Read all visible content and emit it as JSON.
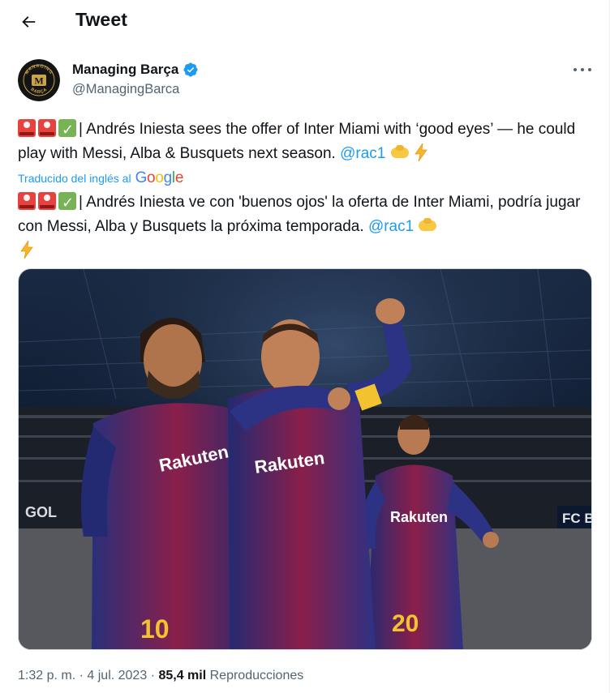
{
  "header": {
    "title": "Tweet",
    "back_icon": "arrow-left-icon"
  },
  "author": {
    "name": "Managing Barça",
    "handle": "@ManagingBarca",
    "avatar_text_top": "MANAGING",
    "avatar_text_bottom": "BARÇA",
    "avatar_monogram": "M",
    "verified_color": "#1d9bf0"
  },
  "tweet": {
    "text_en": "| Andrés Iniesta sees the offer of Inter Miami with ‘good eyes’ — he could play with Messi, Alba & Busquets next season.",
    "mention_en": "@rac1",
    "translated_label": "Traducido del inglés al",
    "translated_brand": [
      "G",
      "o",
      "o",
      "g",
      "l",
      "e"
    ],
    "text_es": "| Andrés Iniesta ve con 'buenos ojos' la oferta de Inter Miami, podría jugar con Messi, Alba y Busquets la próxima temporada.",
    "mention_es": "@rac1",
    "emojis": [
      "police-light-icon",
      "police-light-icon",
      "check-mark-icon",
      "handshake-icon",
      "lightning-icon"
    ]
  },
  "media": {
    "jersey_text": "Rakuten",
    "number_left": "10",
    "number_right": "20",
    "banner_left": "GOL",
    "banner_right": "FC B"
  },
  "meta": {
    "time": "1:32 p. m.",
    "separator": "·",
    "date": "4 jul. 2023",
    "views_count": "85,4 mil",
    "views_label": "Reproducciones"
  },
  "colors": {
    "accent": "#1d9bf0",
    "secondary_text": "#536471",
    "primary_text": "#0f1419"
  }
}
